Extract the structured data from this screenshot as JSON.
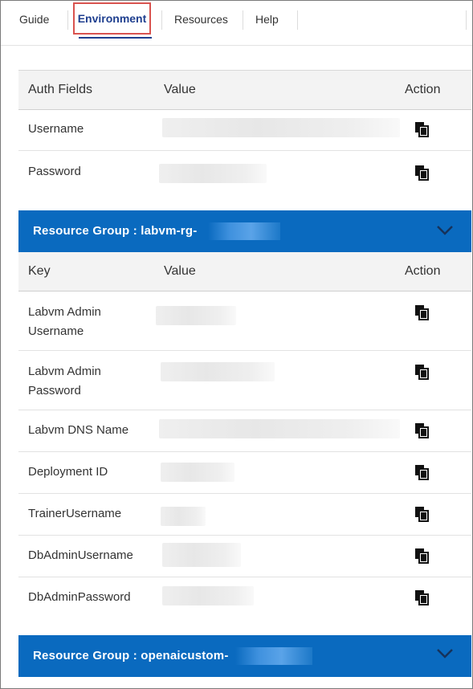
{
  "tabs": [
    {
      "label": "Guide"
    },
    {
      "label": "Environment"
    },
    {
      "label": "Resources"
    },
    {
      "label": "Help"
    }
  ],
  "auth_table": {
    "headers": {
      "col1": "Auth Fields",
      "col2": "Value",
      "col3": "Action"
    },
    "rows": [
      {
        "key": "Username"
      },
      {
        "key": "Password"
      }
    ]
  },
  "resource_groups": [
    {
      "title": "Resource Group : labvm-rg-",
      "headers": {
        "col1": "Key",
        "col2": "Value",
        "col3": "Action"
      },
      "rows": [
        {
          "key": "Labvm Admin Username"
        },
        {
          "key": "Labvm Admin Password"
        },
        {
          "key": "Labvm DNS Name"
        },
        {
          "key": "Deployment ID"
        },
        {
          "key": "TrainerUsername"
        },
        {
          "key": "DbAdminUsername"
        },
        {
          "key": "DbAdminPassword"
        }
      ]
    },
    {
      "title": "Resource Group : openaicustom-"
    }
  ],
  "colors": {
    "accent": "#0a6abf",
    "active_tab": "#1f3f8f",
    "highlight": "#d9534f"
  }
}
